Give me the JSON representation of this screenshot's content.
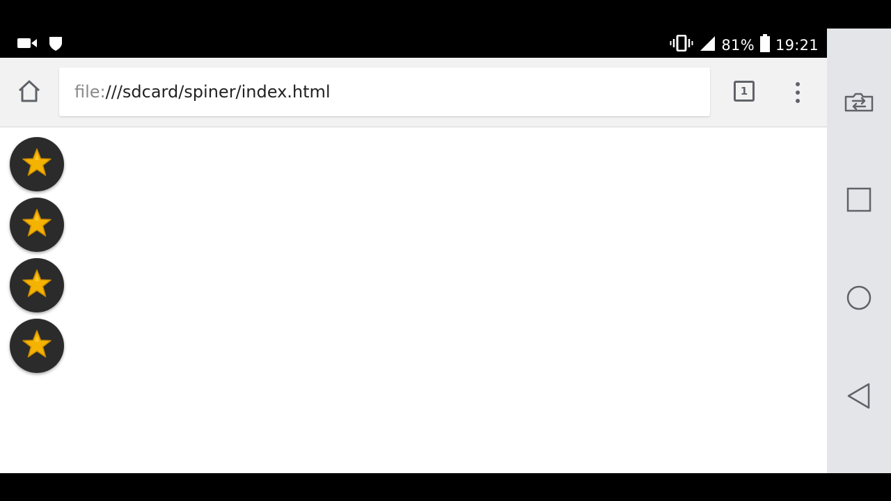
{
  "status_bar": {
    "left_icons": [
      "video-camera-icon",
      "shield-icon"
    ],
    "battery_percent": "81%",
    "time": "19:21",
    "right_icons": [
      "vibrate-icon",
      "signal-icon",
      "battery-icon"
    ]
  },
  "browser": {
    "url_scheme": "file:",
    "url_path": "///sdcard/spiner/index.html",
    "tab_count": "1",
    "icons": [
      "home-icon",
      "tab-switcher-icon",
      "more-vert-icon"
    ]
  },
  "page": {
    "star_buttons": [
      {
        "icon": "star-icon"
      },
      {
        "icon": "star-icon"
      },
      {
        "icon": "star-icon"
      },
      {
        "icon": "star-icon"
      }
    ],
    "colors": {
      "button_bg": "#2b2b2b",
      "star_fill": "#f5b301",
      "star_stroke": "#c98a00"
    }
  },
  "nav_bar": {
    "buttons": [
      "switch-app-icon",
      "recents-icon",
      "home-circle-icon",
      "back-icon"
    ]
  }
}
